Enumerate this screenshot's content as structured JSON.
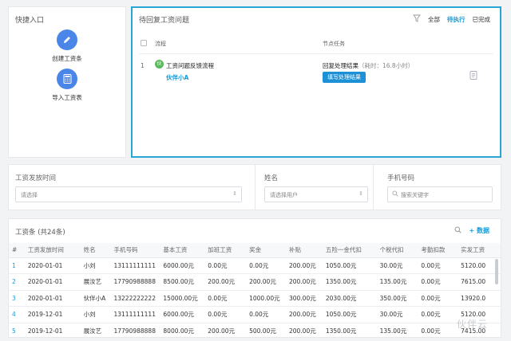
{
  "quick": {
    "title": "快捷入口",
    "items": [
      {
        "label": "创建工资条",
        "icon": "pencil-icon"
      },
      {
        "label": "导入工资表",
        "icon": "calculator-icon"
      }
    ]
  },
  "pending": {
    "title": "待回复工资问题",
    "filters": [
      {
        "label": "全部",
        "active": false
      },
      {
        "label": "待执行",
        "active": true
      },
      {
        "label": "已完成",
        "active": false
      }
    ],
    "columns": {
      "flow": "流程",
      "task": "节点任务"
    },
    "rows": [
      {
        "num": "1",
        "avatar": "伙",
        "flow_name": "工资问题反馈流程",
        "user": "伙伴小A",
        "task": "回复处理结果",
        "time": "（耗时：16.8小时）",
        "button": "填写处理结果"
      }
    ]
  },
  "filters": {
    "date": {
      "label": "工资发放时间",
      "placeholder": "请选择"
    },
    "name": {
      "label": "姓名",
      "placeholder": "请选择用户"
    },
    "phone": {
      "label": "手机号码",
      "placeholder": "搜索关键字"
    }
  },
  "table": {
    "title": "工资条 (共24条)",
    "add_label": "数据",
    "columns": [
      "#",
      "工资发放时间",
      "姓名",
      "手机号码",
      "基本工资",
      "加班工资",
      "奖金",
      "补贴",
      "五险一金代扣",
      "个税代扣",
      "考勤扣款",
      "实发工资"
    ],
    "rows": [
      [
        "1",
        "2020-01-01",
        "小刘",
        "13111111111",
        "6000.00元",
        "0.00元",
        "0.00元",
        "200.00元",
        "1050.00元",
        "30.00元",
        "0.00元",
        "5120.00"
      ],
      [
        "2",
        "2020-01-01",
        "展汝艺",
        "17790988888",
        "8500.00元",
        "200.00元",
        "200.00元",
        "200.00元",
        "1350.00元",
        "135.00元",
        "0.00元",
        "7615.00"
      ],
      [
        "3",
        "2020-01-01",
        "伙伴小A",
        "13222222222",
        "15000.00元",
        "0.00元",
        "1000.00元",
        "300.00元",
        "2030.00元",
        "350.00元",
        "0.00元",
        "13920.0"
      ],
      [
        "4",
        "2019-12-01",
        "小刘",
        "13111111111",
        "6000.00元",
        "0.00元",
        "0.00元",
        "200.00元",
        "1050.00元",
        "30.00元",
        "0.00元",
        "5120.00"
      ],
      [
        "5",
        "2019-12-01",
        "展汝艺",
        "17790988888",
        "8000.00元",
        "200.00元",
        "500.00元",
        "200.00元",
        "1350.00元",
        "135.00元",
        "0.00元",
        "7415.00"
      ]
    ]
  },
  "watermark": "伙伴云"
}
